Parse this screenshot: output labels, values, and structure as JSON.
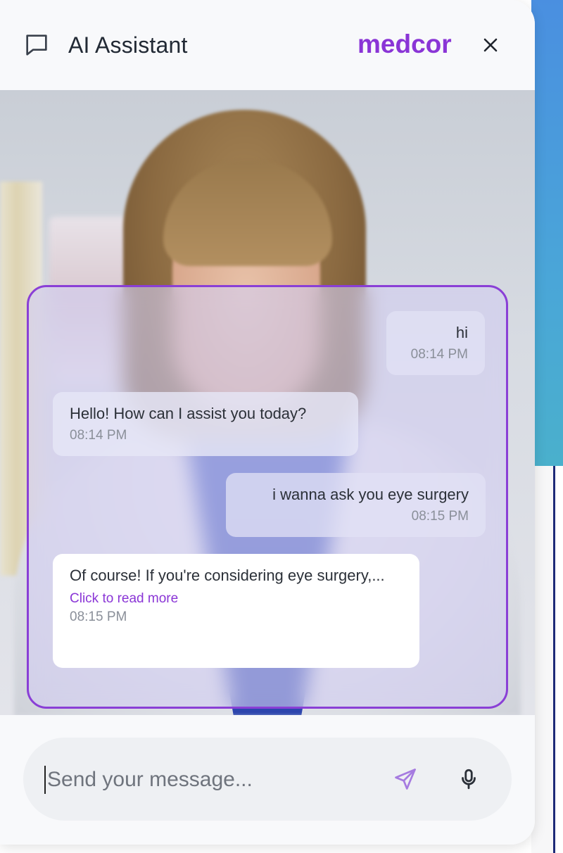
{
  "header": {
    "title": "AI Assistant",
    "brand": "medcor",
    "icons": {
      "chat": "chat-bubble-icon",
      "close": "close-icon"
    }
  },
  "messages": [
    {
      "role": "user",
      "text": "hi",
      "time": "08:14 PM"
    },
    {
      "role": "assistant",
      "text": "Hello! How can I assist you today?",
      "time": "08:14 PM"
    },
    {
      "role": "user",
      "text": "i wanna ask you eye surgery",
      "time": "08:15 PM"
    },
    {
      "role": "assistant",
      "text": "Of course! If you're considering eye surgery,...",
      "read_more": "Click to read more",
      "time": "08:15 PM"
    }
  ],
  "composer": {
    "placeholder": "Send your message...",
    "value": "",
    "icons": {
      "send": "send-icon",
      "mic": "microphone-icon"
    }
  },
  "colors": {
    "accent": "#8a35d6",
    "panel_border": "#8a3fd6",
    "backdrop": "#4a9ee0"
  }
}
